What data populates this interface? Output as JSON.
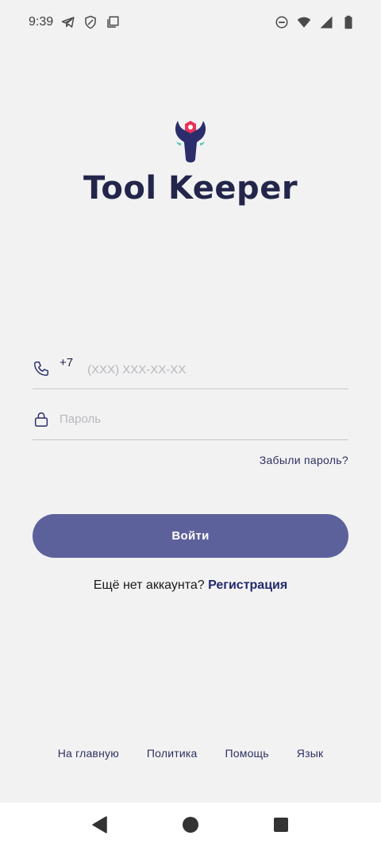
{
  "status_bar": {
    "time": "9:39",
    "left_icons": [
      "telegram-icon",
      "shield-icon",
      "copy-icon"
    ],
    "right_icons": [
      "do-not-disturb-icon",
      "wifi-icon",
      "signal-icon",
      "battery-icon"
    ]
  },
  "brand": {
    "name": "Tool Keeper",
    "logo_icon": "wrench-nut-logo-icon",
    "colors": {
      "primary": "#2b2e6b",
      "accent": "#e8335a",
      "teal": "#58c6b8"
    }
  },
  "form": {
    "phone": {
      "icon": "phone-icon",
      "prefix": "+7",
      "placeholder": "(XXX) XXX-XX-XX",
      "value": ""
    },
    "password": {
      "icon": "lock-icon",
      "placeholder": "Пароль",
      "value": ""
    },
    "forgot_label": "Забыли пароль?",
    "submit_label": "Войти",
    "submit_color": "#5d619b"
  },
  "signup": {
    "prompt": "Ещё нет аккаунта?",
    "link": "Регистрация"
  },
  "footer": {
    "links": [
      "На главную",
      "Политика",
      "Помощь",
      "Язык"
    ]
  },
  "system_nav": {
    "buttons": [
      "back-icon",
      "home-icon",
      "recents-icon"
    ]
  }
}
